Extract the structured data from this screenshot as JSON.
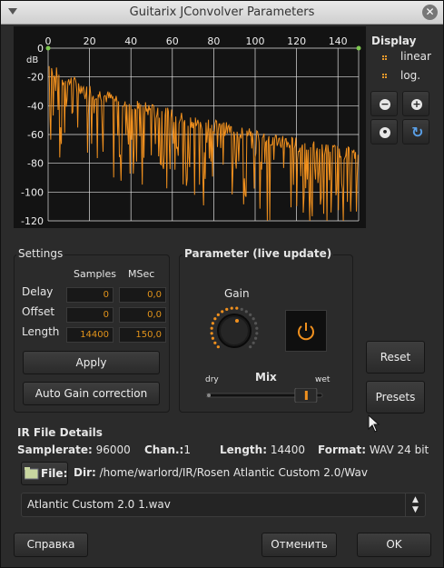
{
  "window": {
    "title": "Guitarix JConvolver Parameters",
    "close_glyph": "✕"
  },
  "plot": {
    "x_ticks": [
      "0",
      "20",
      "40",
      "60",
      "80",
      "100",
      "120",
      "140"
    ],
    "y_ticks": [
      "0",
      "-20",
      "-40",
      "-60",
      "-80",
      "-100",
      "-120"
    ],
    "y_unit": "dB",
    "line_color": "#f0901e",
    "grid_color": "#e0e0e0"
  },
  "display": {
    "title": "Display",
    "options": [
      {
        "label": "linear",
        "selected": false
      },
      {
        "label": "log.",
        "selected": true
      }
    ],
    "buttons": [
      {
        "name": "zoom-out",
        "glyph": "−"
      },
      {
        "name": "zoom-in",
        "glyph": "+"
      },
      {
        "name": "zoom-reset",
        "glyph": "•"
      },
      {
        "name": "refresh",
        "glyph": "↻"
      }
    ]
  },
  "settings": {
    "title": "Settings",
    "col_samples": "Samples",
    "col_msec": "MSec",
    "rows": [
      {
        "label": "Delay",
        "samples": "0",
        "msec": "0,0"
      },
      {
        "label": "Offset",
        "samples": "0",
        "msec": "0,0"
      },
      {
        "label": "Length",
        "samples": "14400",
        "msec": "150,0"
      }
    ],
    "apply": "Apply",
    "auto_gain": "Auto Gain correction"
  },
  "parameter": {
    "title": "Parameter (live update)",
    "gain_label": "Gain",
    "mix_label": "Mix",
    "dry": "dry",
    "wet": "wet",
    "mix_value": 0.88
  },
  "right_buttons": {
    "reset": "Reset",
    "presets": "Presets"
  },
  "ir": {
    "title": "IR File Details",
    "samplerate_label": "Samplerate:",
    "samplerate": "96000",
    "chan_label": "Chan.:",
    "chan": "1",
    "length_label": "Length:",
    "length": "14400",
    "format_label": "Format:",
    "format": "WAV 24 bit",
    "file_button": "File:",
    "dir_label": "Dir:",
    "dir": "/home/warlord/IR/Rosen Atlantic Custom 2.0/Wav",
    "selected_file": "Atlantic Custom 2.0 1.wav"
  },
  "footer": {
    "help": "Справка",
    "cancel": "Отменить",
    "ok": "OK"
  }
}
